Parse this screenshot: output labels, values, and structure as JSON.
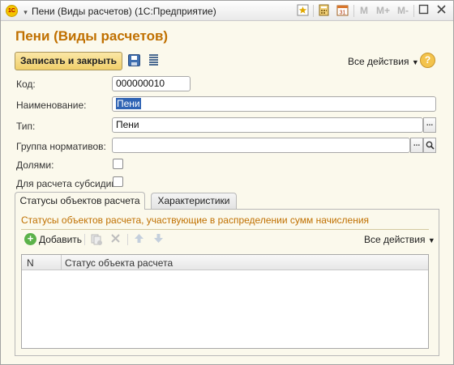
{
  "window": {
    "title": "Пени (Виды расчетов)  (1С:Предприятие)",
    "logo_text": "1С"
  },
  "titlebar_buttons": {
    "m": "M",
    "m_plus": "M+",
    "m_minus": "M-"
  },
  "form": {
    "title": "Пени (Виды расчетов)",
    "save_close_label": "Записать и закрыть",
    "all_actions_label": "Все действия",
    "help_label": "?"
  },
  "fields": {
    "code": {
      "label": "Код:",
      "value": "000000010"
    },
    "name": {
      "label": "Наименование:",
      "value": "Пени"
    },
    "type": {
      "label": "Тип:",
      "value": "Пени"
    },
    "norm_group": {
      "label": "Группа нормативов:",
      "value": ""
    },
    "shares": {
      "label": "Долями:",
      "checked": false
    },
    "subsidy": {
      "label": "Для расчета субсидии:",
      "checked": false
    }
  },
  "tabs": [
    {
      "label": "Статусы объектов расчета",
      "active": true
    },
    {
      "label": "Характеристики",
      "active": false
    }
  ],
  "statuses_panel": {
    "group_title": "Статусы объектов расчета, участвующие в распределении сумм начисления",
    "add_label": "Добавить",
    "all_actions_label": "Все действия",
    "table": {
      "columns": [
        "N",
        "Статус объекта расчета"
      ],
      "rows": []
    }
  },
  "colors": {
    "title_accent": "#c07000",
    "save_button": "#f0cf6a",
    "selection": "#2f63b4",
    "background": "#fbf9ec"
  }
}
